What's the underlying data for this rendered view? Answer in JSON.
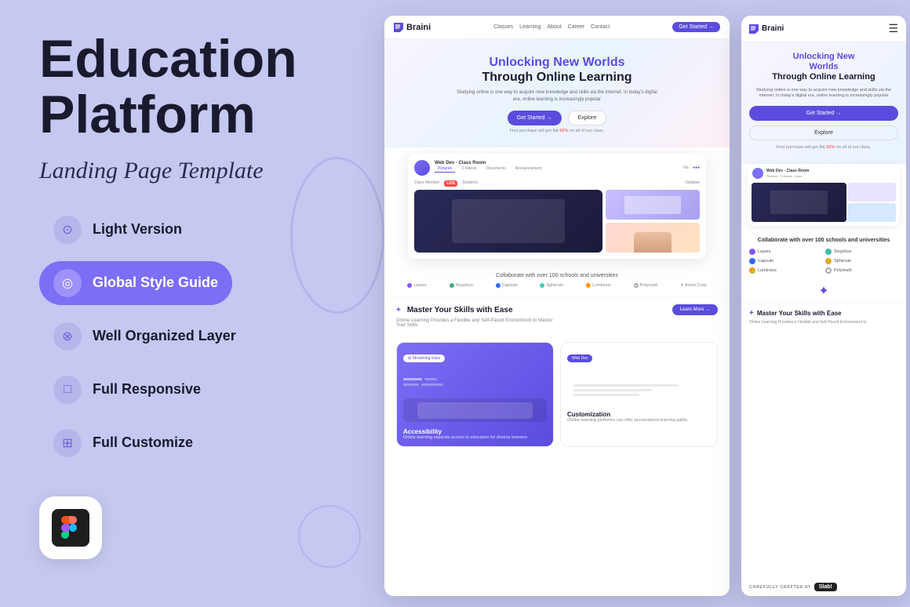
{
  "left": {
    "title_line1": "Education",
    "title_line2": "Platform",
    "subtitle": "Landing Page Template",
    "features": [
      {
        "id": "light-version",
        "label": "Light Version",
        "active": false,
        "icon": "⊙"
      },
      {
        "id": "global-style-guide",
        "label": "Global Style Guide",
        "active": true,
        "icon": "◎"
      },
      {
        "id": "well-organized-layer",
        "label": "Well Organized Layer",
        "active": false,
        "icon": "⊗"
      },
      {
        "id": "full-responsive",
        "label": "Full Responsive",
        "active": false,
        "icon": "□"
      },
      {
        "id": "full-customize",
        "label": "Full Customize",
        "active": false,
        "icon": "⊞"
      }
    ],
    "figma_label": "Figma"
  },
  "center_preview": {
    "nav": {
      "brand": "Braini",
      "links": [
        "Classes",
        "Learning",
        "About",
        "Career",
        "Contact"
      ],
      "cta": "Get Started →"
    },
    "hero": {
      "title_colored": "Unlocking New Worlds",
      "title_dark": "Through Online Learning",
      "description": "Studying online is one way to acquire new knowledge and skills via the internet. In today's digital era, online learning is increasingly popular",
      "btn_primary": "Get Started →",
      "btn_secondary": "Explore",
      "note_prefix": "First purchase will get flat",
      "note_highlight": "50%",
      "note_suffix": "on all of our class."
    },
    "class_card": {
      "title": "Web Dev - Class Room",
      "tabs": [
        "Pictures",
        "3 Videos",
        "Documents",
        "Announcement"
      ],
      "members_label": "Class Member",
      "live_badge": "LIVE",
      "students_label": "Students",
      "updates_label": "Updates"
    },
    "partners": {
      "title": "Collaborate with over 100 schools and universities",
      "logos": [
        "Layers",
        "Sisyphus",
        "Capsule",
        "Spherule",
        "Luminous",
        "Polymath",
        "Acme Corp"
      ]
    },
    "skills": {
      "plus": "+",
      "title": "Master Your Skills with Ease",
      "description": "Online Learning Provides a Flexible and Self-Paced Environment to Master Your Skills",
      "btn": "Learn More →"
    },
    "cards": [
      {
        "type": "purple",
        "badge": "Streaming class",
        "title": "Accessibility",
        "description": "Online learning expands access to education for diverse learners"
      },
      {
        "type": "white",
        "badge": "Web Dev",
        "title": "Customization",
        "description": "Online learning platforms can offer personalized learning paths."
      }
    ]
  },
  "right_preview": {
    "nav": {
      "brand": "Braini",
      "menu_icon": "☰"
    },
    "hero": {
      "title_colored": "Unlocking New",
      "title_colored2": "Worlds",
      "title_dark": "Through Online Learning",
      "description": "Studying online is one way to acquire new knowledge and skills via the internet. In today's digital era, online learning is increasingly popular",
      "btn_primary": "Get Started →",
      "btn_secondary": "Explore",
      "note_prefix": "First purchase will get flat",
      "note_highlight": "50%",
      "note_suffix": "on all of our class."
    },
    "partners": {
      "title": "Collaborate with over 100 schools and universities",
      "logos": [
        {
          "name": "Layers",
          "color": "purple"
        },
        {
          "name": "Sisyphus",
          "color": "green"
        },
        {
          "name": "Capsule",
          "color": "blue"
        },
        {
          "name": "Spherule",
          "color": "yellow"
        },
        {
          "name": "Luminous",
          "color": "multi"
        },
        {
          "name": "Polymath",
          "color": "circle"
        }
      ]
    },
    "skills": {
      "plus": "+",
      "title": "Master Your Skills with Ease",
      "description": "Online Learning Provides a Flexible and Self-Paced Environment to"
    },
    "footer": {
      "crafted_text": "CAREFULLY CRAFTED AT",
      "badge": "Slab!"
    }
  }
}
